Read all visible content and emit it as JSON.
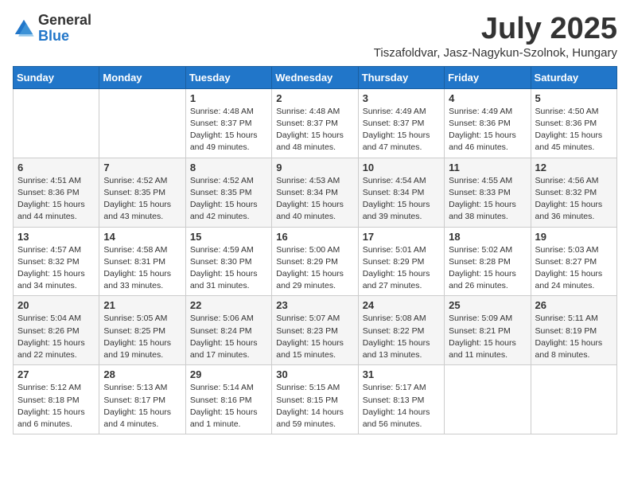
{
  "logo": {
    "general": "General",
    "blue": "Blue"
  },
  "title": {
    "month": "July 2025",
    "location": "Tiszafoldvar, Jasz-Nagykun-Szolnok, Hungary"
  },
  "headers": [
    "Sunday",
    "Monday",
    "Tuesday",
    "Wednesday",
    "Thursday",
    "Friday",
    "Saturday"
  ],
  "weeks": [
    [
      {
        "day": "",
        "info": ""
      },
      {
        "day": "",
        "info": ""
      },
      {
        "day": "1",
        "info": "Sunrise: 4:48 AM\nSunset: 8:37 PM\nDaylight: 15 hours and 49 minutes."
      },
      {
        "day": "2",
        "info": "Sunrise: 4:48 AM\nSunset: 8:37 PM\nDaylight: 15 hours and 48 minutes."
      },
      {
        "day": "3",
        "info": "Sunrise: 4:49 AM\nSunset: 8:37 PM\nDaylight: 15 hours and 47 minutes."
      },
      {
        "day": "4",
        "info": "Sunrise: 4:49 AM\nSunset: 8:36 PM\nDaylight: 15 hours and 46 minutes."
      },
      {
        "day": "5",
        "info": "Sunrise: 4:50 AM\nSunset: 8:36 PM\nDaylight: 15 hours and 45 minutes."
      }
    ],
    [
      {
        "day": "6",
        "info": "Sunrise: 4:51 AM\nSunset: 8:36 PM\nDaylight: 15 hours and 44 minutes."
      },
      {
        "day": "7",
        "info": "Sunrise: 4:52 AM\nSunset: 8:35 PM\nDaylight: 15 hours and 43 minutes."
      },
      {
        "day": "8",
        "info": "Sunrise: 4:52 AM\nSunset: 8:35 PM\nDaylight: 15 hours and 42 minutes."
      },
      {
        "day": "9",
        "info": "Sunrise: 4:53 AM\nSunset: 8:34 PM\nDaylight: 15 hours and 40 minutes."
      },
      {
        "day": "10",
        "info": "Sunrise: 4:54 AM\nSunset: 8:34 PM\nDaylight: 15 hours and 39 minutes."
      },
      {
        "day": "11",
        "info": "Sunrise: 4:55 AM\nSunset: 8:33 PM\nDaylight: 15 hours and 38 minutes."
      },
      {
        "day": "12",
        "info": "Sunrise: 4:56 AM\nSunset: 8:32 PM\nDaylight: 15 hours and 36 minutes."
      }
    ],
    [
      {
        "day": "13",
        "info": "Sunrise: 4:57 AM\nSunset: 8:32 PM\nDaylight: 15 hours and 34 minutes."
      },
      {
        "day": "14",
        "info": "Sunrise: 4:58 AM\nSunset: 8:31 PM\nDaylight: 15 hours and 33 minutes."
      },
      {
        "day": "15",
        "info": "Sunrise: 4:59 AM\nSunset: 8:30 PM\nDaylight: 15 hours and 31 minutes."
      },
      {
        "day": "16",
        "info": "Sunrise: 5:00 AM\nSunset: 8:29 PM\nDaylight: 15 hours and 29 minutes."
      },
      {
        "day": "17",
        "info": "Sunrise: 5:01 AM\nSunset: 8:29 PM\nDaylight: 15 hours and 27 minutes."
      },
      {
        "day": "18",
        "info": "Sunrise: 5:02 AM\nSunset: 8:28 PM\nDaylight: 15 hours and 26 minutes."
      },
      {
        "day": "19",
        "info": "Sunrise: 5:03 AM\nSunset: 8:27 PM\nDaylight: 15 hours and 24 minutes."
      }
    ],
    [
      {
        "day": "20",
        "info": "Sunrise: 5:04 AM\nSunset: 8:26 PM\nDaylight: 15 hours and 22 minutes."
      },
      {
        "day": "21",
        "info": "Sunrise: 5:05 AM\nSunset: 8:25 PM\nDaylight: 15 hours and 19 minutes."
      },
      {
        "day": "22",
        "info": "Sunrise: 5:06 AM\nSunset: 8:24 PM\nDaylight: 15 hours and 17 minutes."
      },
      {
        "day": "23",
        "info": "Sunrise: 5:07 AM\nSunset: 8:23 PM\nDaylight: 15 hours and 15 minutes."
      },
      {
        "day": "24",
        "info": "Sunrise: 5:08 AM\nSunset: 8:22 PM\nDaylight: 15 hours and 13 minutes."
      },
      {
        "day": "25",
        "info": "Sunrise: 5:09 AM\nSunset: 8:21 PM\nDaylight: 15 hours and 11 minutes."
      },
      {
        "day": "26",
        "info": "Sunrise: 5:11 AM\nSunset: 8:19 PM\nDaylight: 15 hours and 8 minutes."
      }
    ],
    [
      {
        "day": "27",
        "info": "Sunrise: 5:12 AM\nSunset: 8:18 PM\nDaylight: 15 hours and 6 minutes."
      },
      {
        "day": "28",
        "info": "Sunrise: 5:13 AM\nSunset: 8:17 PM\nDaylight: 15 hours and 4 minutes."
      },
      {
        "day": "29",
        "info": "Sunrise: 5:14 AM\nSunset: 8:16 PM\nDaylight: 15 hours and 1 minute."
      },
      {
        "day": "30",
        "info": "Sunrise: 5:15 AM\nSunset: 8:15 PM\nDaylight: 14 hours and 59 minutes."
      },
      {
        "day": "31",
        "info": "Sunrise: 5:17 AM\nSunset: 8:13 PM\nDaylight: 14 hours and 56 minutes."
      },
      {
        "day": "",
        "info": ""
      },
      {
        "day": "",
        "info": ""
      }
    ]
  ]
}
